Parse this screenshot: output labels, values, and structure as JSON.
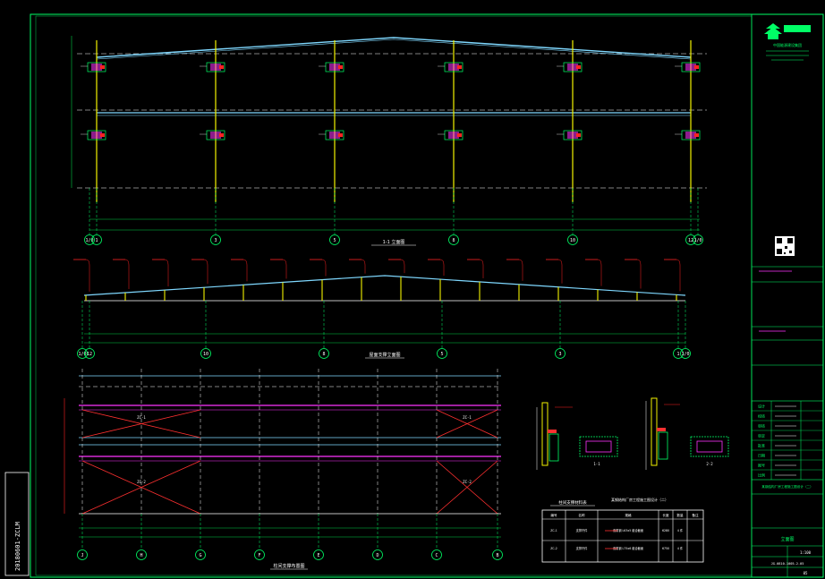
{
  "colors": {
    "background": "#000000",
    "frame": "#00ff66",
    "grid": "#ffffff",
    "roof": "#7fd8ff",
    "column": "#f2f200",
    "brace": "#ff3030",
    "purlin": "#ff33ff",
    "cyanbeam": "#00ffff",
    "redmark": "#ff2222",
    "dim": "#00cc44"
  },
  "elevation_1": {
    "axes": [
      "1/0",
      "1",
      "3",
      "5",
      "8",
      "10",
      "12",
      "1/0"
    ],
    "title": "1-1 立面图"
  },
  "elevation_2": {
    "axes": [
      "1/0",
      "12",
      "10",
      "8",
      "5",
      "3",
      "1",
      "1/0"
    ],
    "title": "屋面支撑立面图"
  },
  "plan": {
    "axes": [
      "J",
      "H",
      "G",
      "F",
      "E",
      "D",
      "C",
      "B"
    ],
    "title": "柱间支撑布置图",
    "brace_labels": [
      "ZC-1",
      "ZC-1",
      "ZC-2",
      "ZC-2"
    ]
  },
  "section_details": {
    "labels": [
      "1-1",
      "2-2"
    ]
  },
  "material_table": {
    "title": "柱间支撑材料表",
    "headers": [
      "编号",
      "名称",
      "规格",
      "长度",
      "数量",
      "备注"
    ],
    "rows": [
      [
        "ZC-1",
        "支撑杆件",
        "双角钢 L63x5 组合截面",
        "6280",
        "4 件",
        ""
      ],
      [
        "ZC-2",
        "支撑杆件",
        "双角钢 L75x6 组合截面",
        "6750",
        "4 件",
        ""
      ]
    ]
  },
  "title_block": {
    "company": "中国能源建设集团",
    "project_name": "某钢结构厂房工程施工图设计（二）",
    "drawing_name": "立面图",
    "drawing_number": "JG-0810-1005-2-05",
    "scale": "1:100",
    "sheet": "05",
    "rows": [
      "设计",
      "校核",
      "审核",
      "审定",
      "批准",
      "日期",
      "图号",
      "比例"
    ]
  },
  "left_stamp": "20180601-ZCLM"
}
